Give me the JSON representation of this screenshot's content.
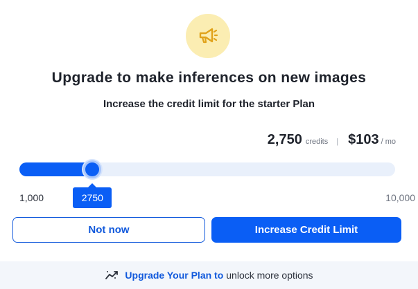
{
  "dialog": {
    "icon": "megaphone-icon",
    "title": "Upgrade to make inferences on new images",
    "subtitle": "Increase the credit limit for the starter Plan"
  },
  "pricing": {
    "credits_value": "2,750",
    "credits_unit": "credits",
    "separator": "|",
    "price_value": "$103",
    "price_unit": "/ mo"
  },
  "slider": {
    "min_label": "1,000",
    "max_label": "10,000",
    "min": 1000,
    "max": 10000,
    "value": 2750,
    "value_label": "2750"
  },
  "buttons": {
    "secondary_label": "Not now",
    "primary_label": "Increase Credit Limit"
  },
  "footer": {
    "icon": "chart-trend-icon",
    "link_text": "Upgrade Your Plan to",
    "rest_text": "unlock more options"
  },
  "colors": {
    "accent": "#0a5ef5",
    "icon_bg": "#fbedb2",
    "icon_fg": "#e0a21a",
    "track_bg": "#e9f0fb"
  }
}
